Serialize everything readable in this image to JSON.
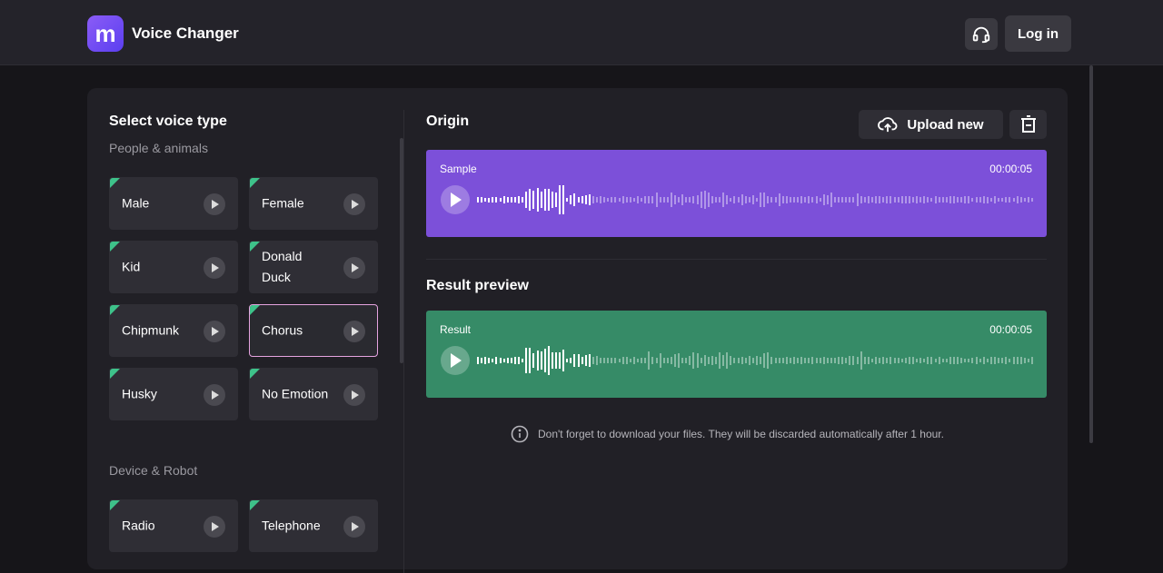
{
  "header": {
    "app_title": "Voice Changer",
    "logo_text": "m",
    "login": "Log in"
  },
  "sidebar": {
    "title": "Select voice type",
    "categories": [
      {
        "label": "People & animals",
        "voices": [
          "Male",
          "Female",
          "Kid",
          "Donald Duck",
          "Chipmunk",
          "Chorus",
          "Husky",
          "No Emotion"
        ]
      },
      {
        "label": "Device & Robot",
        "voices": [
          "Radio",
          "Telephone"
        ]
      }
    ],
    "selected": "Chorus"
  },
  "origin": {
    "title": "Origin",
    "upload": "Upload new",
    "player": {
      "name": "Sample",
      "time": "00:00:05",
      "progress": 0.2
    }
  },
  "result": {
    "title": "Result preview",
    "player": {
      "name": "Result",
      "time": "00:00:05",
      "progress": 0.2
    }
  },
  "notice": "Don't forget to download your files. They will be discarded automatically after 1 hour.",
  "colors": {
    "origin": "#7c50d9",
    "result": "#368b67",
    "accent": "#3ec28a"
  }
}
